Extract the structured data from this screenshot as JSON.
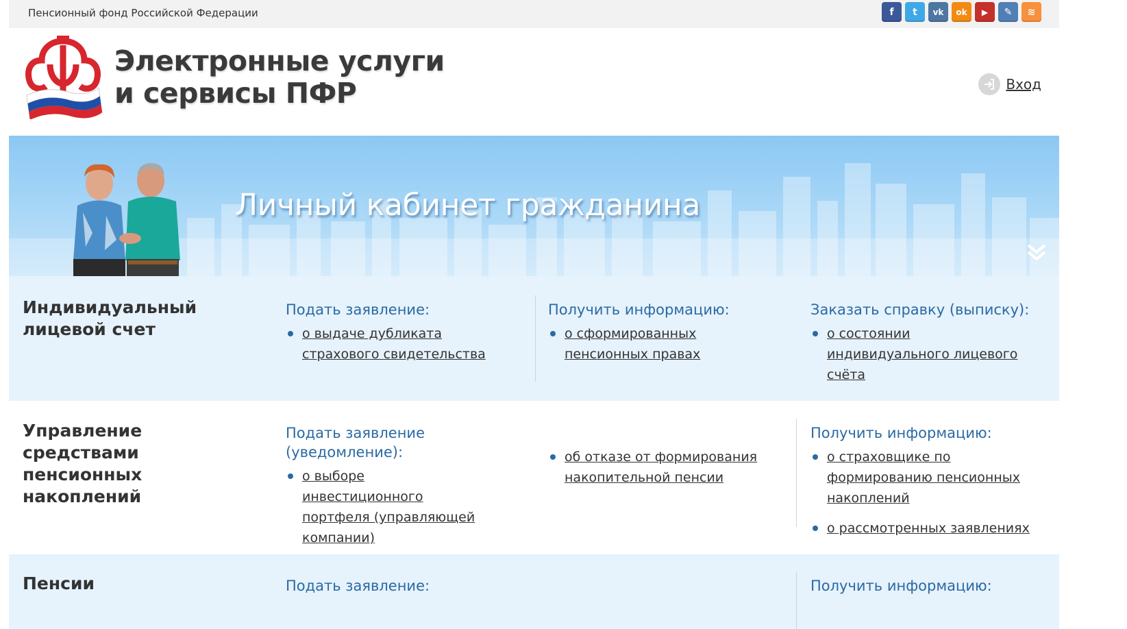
{
  "topbar": {
    "org_name": "Пенсионный фонд Российской Федерации",
    "socials": [
      {
        "icon": "facebook-icon",
        "glyph": "f",
        "color": "#3b5998"
      },
      {
        "icon": "twitter-icon",
        "glyph": "t",
        "color": "#3fa9e8"
      },
      {
        "icon": "vk-icon",
        "glyph": "vk",
        "color": "#4d76a1"
      },
      {
        "icon": "odnoklassniki-icon",
        "glyph": "ok",
        "color": "#f28b13"
      },
      {
        "icon": "youtube-icon",
        "glyph": "▶",
        "color": "#c4302b"
      },
      {
        "icon": "livejournal-icon",
        "glyph": "✎",
        "color": "#4f7fb5"
      },
      {
        "icon": "rss-icon",
        "glyph": "≋",
        "color": "#f7913d"
      }
    ]
  },
  "header": {
    "title_line1": "Электронные услуги",
    "title_line2": "и сервисы ПФР",
    "login_label": "Вход"
  },
  "banner": {
    "title": "Личный кабинет гражданина"
  },
  "sections": [
    {
      "title": "Индивидуальный лицевой счет",
      "columns": [
        {
          "heading": "Подать заявление:",
          "items": [
            "о выдаче дубликата страхового свидетельства"
          ]
        },
        {
          "heading": "Получить информацию:",
          "items": [
            "о сформированных пенсионных правах"
          ]
        },
        {
          "heading": "Заказать справку (выписку):",
          "items": [
            "о состоянии индивидуального лицевого счёта"
          ]
        }
      ]
    },
    {
      "title": "Управление средствами пенсионных накоплений",
      "columns": [
        {
          "heading": "Подать заявление (уведомление):",
          "items": [
            "о выборе инвестиционного портфеля (управляющей компании)"
          ]
        },
        {
          "heading": "",
          "items": [
            "об отказе от формирования накопительной пенсии"
          ]
        },
        {
          "heading": "Получить информацию:",
          "items": [
            "о страховщике по формированию пенсионных накоплений",
            "о рассмотренных заявлениях"
          ]
        }
      ]
    },
    {
      "title": "Пенсии",
      "columns": [
        {
          "heading": "Подать заявление:",
          "items": []
        },
        {
          "heading": "Получить информацию:",
          "items": []
        }
      ]
    }
  ],
  "colors": {
    "accent_blue": "#2a6aa3",
    "section_bg": "#e6f2fc",
    "topbar_bg": "#f2f2f2"
  }
}
